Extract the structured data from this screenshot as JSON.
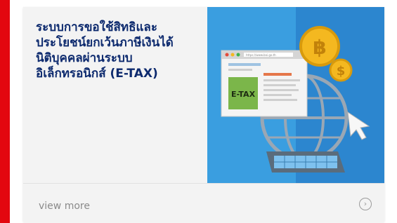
{
  "card": {
    "title": "ระบบการขอใช้สิทธิและประโยชน์ยกเว้นภาษีเงินได้นิติบุคคลผ่านระบบอิเล็กทรอนิกส์ (E-TAX)",
    "image": {
      "badge_text": "E-TAX",
      "coin_symbols": [
        "฿",
        "$"
      ],
      "address_text": "https://www.boi.go.th"
    },
    "footer": {
      "link_label": "view more",
      "chevron_glyph": "›"
    }
  },
  "colors": {
    "accent_bar": "#e3070f",
    "title": "#0d2a6e",
    "image_background": "#3a9ee0",
    "coin": "#f4b820"
  },
  "icons": [
    "chevron-right-icon",
    "baht-coin-icon",
    "dollar-coin-icon",
    "globe-icon",
    "keyboard-icon",
    "cursor-icon"
  ]
}
